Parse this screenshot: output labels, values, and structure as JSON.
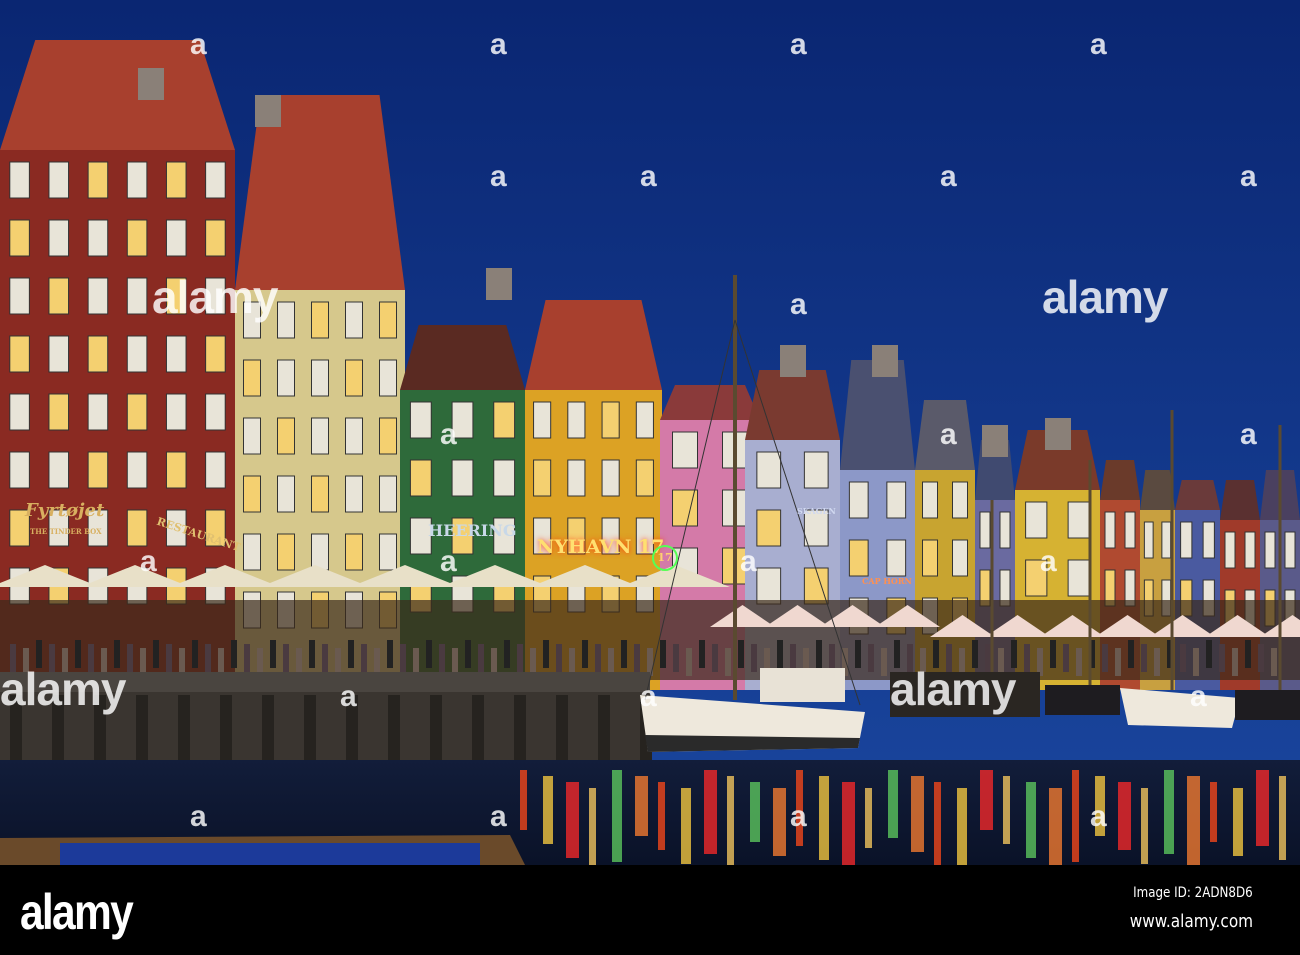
{
  "photo": {
    "signs": {
      "fyrtojet": "Fyrtøjet",
      "tinderbox": "THE TINDER BOX",
      "restaurant": "RESTAURANT",
      "heering": "HEERING",
      "nyhavn": "NYHAVN 17",
      "nyhavn_badge": "17",
      "skagen": "SKAGEN",
      "caphorn": "CAP HORN"
    },
    "colors": {
      "sky_top": "#0a2672",
      "sky_bottom": "#1a47a0",
      "water": "#0b1530",
      "neon": "#ff5a1a"
    }
  },
  "watermark": {
    "logo": "alamy",
    "mark": "a"
  },
  "footer": {
    "logo": "alamy",
    "image_id": "Image ID: 2ADN8D6",
    "url": "www.alamy.com"
  }
}
